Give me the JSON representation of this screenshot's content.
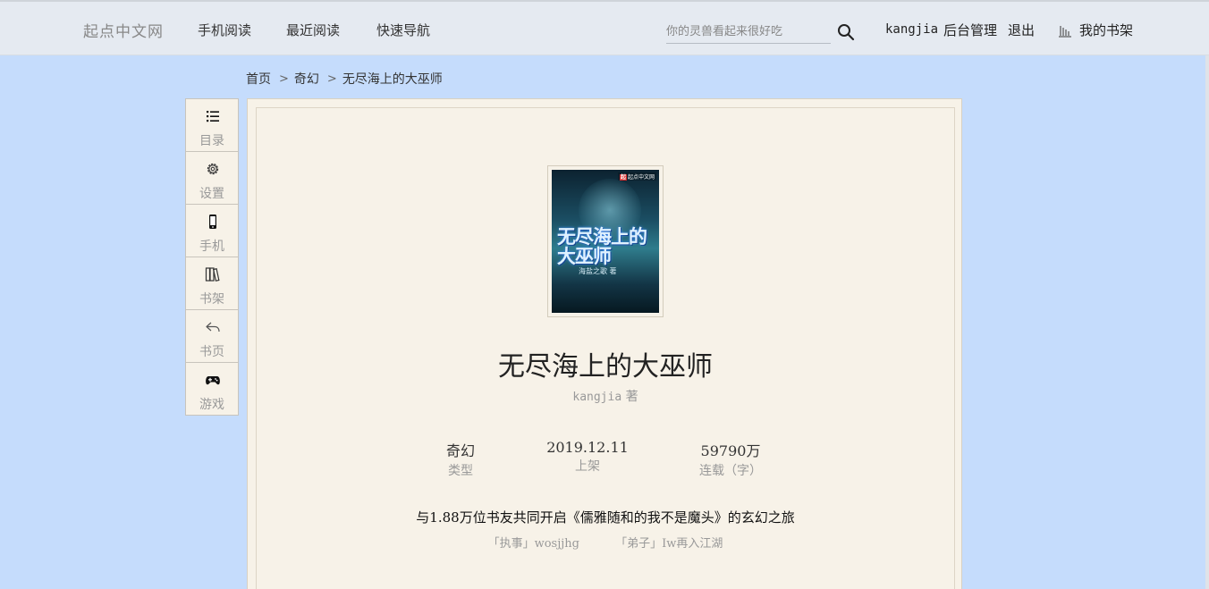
{
  "header": {
    "brand": "起点中文网",
    "nav": [
      "手机阅读",
      "最近阅读",
      "快速导航"
    ],
    "search_placeholder": "你的灵兽看起来很好吃",
    "user_name": "kangjia",
    "admin_label": "后台管理",
    "logout_label": "退出",
    "shelf_label": "我的书架"
  },
  "breadcrumb": [
    "首页",
    "奇幻",
    "无尽海上的大巫师"
  ],
  "toolbar": [
    "目录",
    "设置",
    "手机",
    "书架",
    "书页",
    "游戏"
  ],
  "book": {
    "cover": {
      "title": "无尽海上的大巫师",
      "author": "海盐之歌 著",
      "brand_mark": "起",
      "brand": "起点中文网"
    },
    "title": "无尽海上的大巫师",
    "author": "kangjia",
    "author_suffix": "著",
    "stats": [
      {
        "value": "奇幻",
        "label": "类型"
      },
      {
        "value": "2019.12.11",
        "label": "上架"
      },
      {
        "value": "59790万",
        "label": "连载（字）"
      }
    ],
    "description": "与1.88万位书友共同开启《儒雅随和的我不是魔头》的玄幻之旅",
    "roles": [
      "「执事」wosjjhg",
      "「弟子」Iw再入江湖"
    ]
  },
  "colors": {
    "page_bg": "#c5dcfc",
    "header_bg": "#e5eaf1",
    "paper_bg": "#f7f2e8"
  }
}
